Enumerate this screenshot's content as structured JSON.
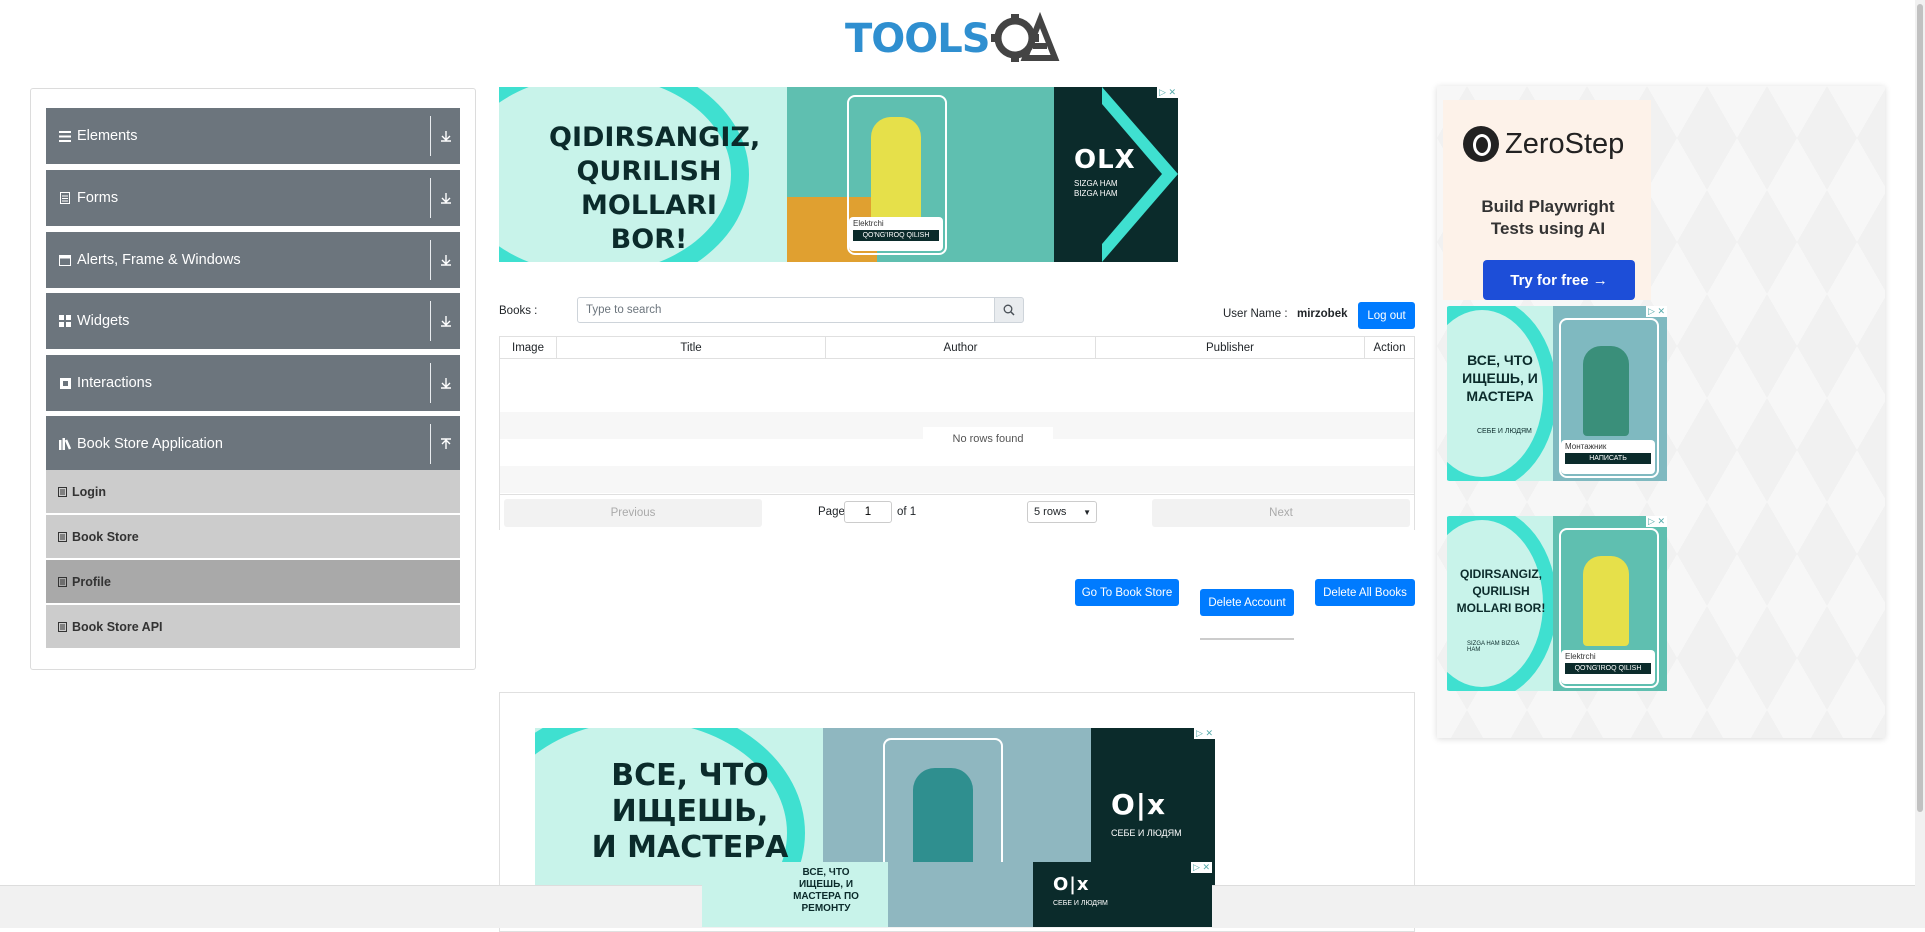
{
  "header": {
    "logo_text": "TOOLSQA"
  },
  "sidebar": {
    "groups": [
      {
        "label": "Elements",
        "icon": "hamburger-icon"
      },
      {
        "label": "Forms",
        "icon": "form-icon"
      },
      {
        "label": "Alerts, Frame & Windows",
        "icon": "window-icon"
      },
      {
        "label": "Widgets",
        "icon": "grid-icon"
      },
      {
        "label": "Interactions",
        "icon": "interaction-icon"
      },
      {
        "label": "Book Store Application",
        "icon": "library-icon"
      }
    ],
    "book_store_items": [
      {
        "label": "Login"
      },
      {
        "label": "Book Store"
      },
      {
        "label": "Profile",
        "active": true
      },
      {
        "label": "Book Store API"
      }
    ]
  },
  "books": {
    "label": "Books :",
    "search_placeholder": "Type to search",
    "username_label": "User Name :",
    "username_value": "mirzobek",
    "logout_label": "Log out"
  },
  "table": {
    "columns": [
      "Image",
      "Title",
      "Author",
      "Publisher",
      "Action"
    ],
    "empty_text": "No rows found",
    "pagination": {
      "previous": "Previous",
      "page_label": "Page",
      "page_value": "1",
      "of_label": "of 1",
      "rows_option": "5 rows",
      "next": "Next"
    }
  },
  "actions": {
    "go_to_store": "Go To Book Store",
    "delete_account": "Delete Account",
    "delete_all_books": "Delete All Books"
  },
  "ads": {
    "top_banner": {
      "headline_lines": [
        "QIDIRSANGIZ,",
        "QURILISH",
        "MOLLARI BOR!"
      ],
      "brand": "OLX",
      "tag": "SIZGA HAM BIZGA HAM",
      "card_name": "Elektrchi",
      "card_button": "QO'NG'IROQ QILISH"
    },
    "zerostep": {
      "brand": "ZeroStep",
      "headline": "Build Playwright Tests using AI",
      "cta": "Try for free →"
    },
    "right_ru": {
      "headline_lines": [
        "ВСЕ, ЧТО",
        "ИЩЕШЬ, И",
        "МАСТЕРА"
      ],
      "tag": "СЕБЕ И ЛЮДЯМ",
      "card_name": "Монтажник",
      "card_button": "НАПИСАТЬ"
    },
    "right_uz": {
      "headline_lines": [
        "QIDIRSANGIZ,",
        "QURILISH",
        "MOLLARI BOR!"
      ],
      "tag": "SIZGA HAM BIZGA HAM",
      "card_name": "Elektrchi",
      "card_button": "QO'NG'IROQ QILISH"
    },
    "bottom_ru": {
      "headline_lines": [
        "ВСЕ, ЧТО",
        "ИЩЕШЬ,",
        "И МАСТЕРА"
      ],
      "tag": "СЕБЕ И ЛЮДЯМ"
    },
    "sticky_ru": {
      "headline_lines": [
        "ВСЕ, ЧТО",
        "ИЩЕШЬ, И",
        "МАСТЕРА ПО",
        "РЕМОНТУ"
      ],
      "tag": "СЕБЕ И ЛЮДЯМ"
    }
  },
  "colors": {
    "primary": "#007bff",
    "sidebar_group": "#6c757d",
    "teal": "#3fe0d0",
    "dark_teal": "#0b2b2b",
    "zerostep_blue": "#1d4ed8"
  }
}
